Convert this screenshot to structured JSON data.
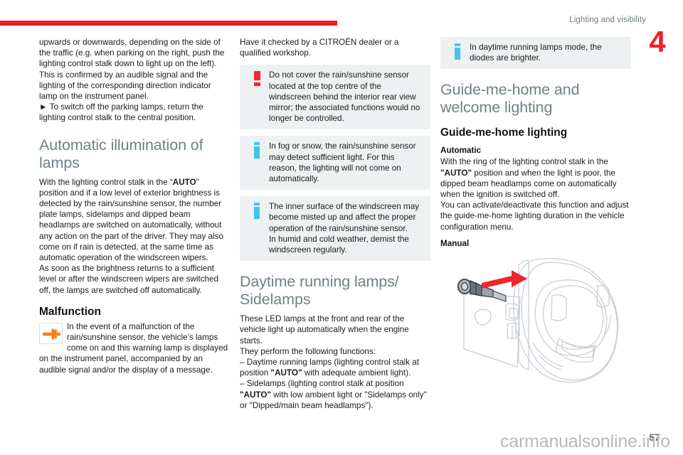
{
  "header": {
    "title": "Lighting and visibility",
    "chapter_number": "4",
    "rule_color": "#ee1c25"
  },
  "footer": {
    "page_number": "57",
    "watermark": "carmanualsonline.info"
  },
  "columns": {
    "left": {
      "paragraphs": [
        "upwards or downwards, depending on the side of the traffic (e.g. when parking on the right, push the lighting control stalk down to light up on the left).",
        "This is confirmed by an audible signal and the lighting of the corresponding direction indicator lamp on the instrument panel.",
        "► To switch off the parking lamps, return the lighting control stalk to the central position."
      ],
      "heading_automatic": "Automatic illumination of lamps",
      "automatic_text_1": "With the lighting control stalk in the “",
      "automatic_auto": "AUTO",
      "automatic_text_2": "” position and if a low level of exterior brightness is detected by the rain/sunshine sensor, the number plate lamps, sidelamps and dipped beam headlamps are switched on automatically, without any action on the part of the driver. They may also come on if rain is detected, at the same time as automatic operation of the windscreen wipers.",
      "automatic_text_3": "As soon as the brightness returns to a sufficient level or after the windscreen wipers are switched off, the lamps are switched off automatically.",
      "heading_malfunction": "Malfunction",
      "malfunction_icon": "wrench-warning-lamp-icon",
      "malfunction_text": "In the event of a malfunction of the rain/sunshine sensor, the vehicle’s lamps come on and this warning lamp is displayed on the instrument panel, accompanied by an audible signal and/or the display of a message."
    },
    "middle": {
      "intro": "Have it checked by a CITROËN dealer or a qualified workshop.",
      "callouts": [
        {
          "icon": "danger-exclamation-icon",
          "text": "Do not cover the rain/sunshine sensor located at the top centre of the windscreen behind the interior rear view mirror; the associated functions would no longer be controlled."
        },
        {
          "icon": "info-icon",
          "text": "In fog or snow, the rain/sunshine sensor may detect sufficient light. For this reason, the lighting will not come on automatically."
        },
        {
          "icon": "info-icon",
          "text": "The inner surface of the windscreen may become misted up and affect the proper operation of the rain/sunshine sensor.\nIn humid and cold weather, demist the windscreen regularly."
        }
      ],
      "heading_daytime": "Daytime running lamps/ Sidelamps",
      "daytime_text_1": "These LED lamps at the front and rear of the vehicle light up automatically when the engine starts.",
      "daytime_text_2": "They perform the following functions:",
      "daytime_item_1_a": "–  Daytime running lamps (lighting control stalk at position ",
      "daytime_item_1_auto": "\"AUTO\"",
      "daytime_item_1_b": " with adequate ambient light).",
      "daytime_item_2_a": "–  Sidelamps (lighting control stalk at position ",
      "daytime_item_2_auto": "\"AUTO\"",
      "daytime_item_2_b": " with low ambient light or \"Sidelamps only\" or \"Dipped/main beam headlamps\")."
    },
    "right": {
      "callout": {
        "icon": "info-icon",
        "text": "In daytime running lamps mode, the diodes are brighter."
      },
      "heading_guide": "Guide-me-home and welcome lighting",
      "heading_guide_lighting": "Guide-me-home lighting",
      "subheading_automatic": "Automatic",
      "automatic_text_1": "With the ring of the lighting control stalk in the ",
      "automatic_auto": "\"AUTO\"",
      "automatic_text_2": " position and when the light is poor, the dipped beam headlamps come on automatically when the ignition is switched off.",
      "automatic_text_3": "You can activate/deactivate this function and adjust the guide-me-home lighting duration in the vehicle configuration menu.",
      "subheading_manual": "Manual",
      "figure": {
        "name": "steering-wheel-lighting-stalk-illustration",
        "arrow_color": "#e8262e",
        "line_color": "#c9ced6"
      }
    }
  },
  "colors": {
    "heading": "#6f8184",
    "body_text": "#1b1b1b",
    "callout_bg": "#eef1f2",
    "danger": "#f42534",
    "info": "#3ec6ef",
    "accent_red": "#ee1c25",
    "wrench_orange": "#f58220"
  }
}
